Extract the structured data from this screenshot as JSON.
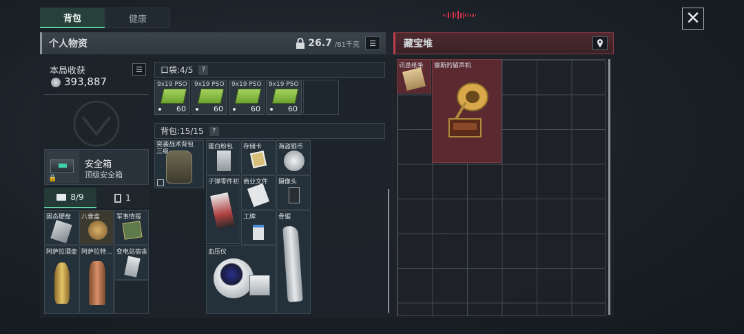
{
  "tabs": {
    "backpack": "背包",
    "health": "健康"
  },
  "left_panel": {
    "title": "个人物资",
    "weight_value": "26.7",
    "weight_capacity": "/81千克"
  },
  "earnings": {
    "label": "本局收获",
    "value": "393,887"
  },
  "safe_box": {
    "name": "安全箱",
    "type": "顶级安全箱"
  },
  "sub_tabs": {
    "count_a": "8/9",
    "count_b": "1"
  },
  "safe_items": [
    "固态硬盘",
    "八音盒",
    "军事情报",
    "阿萨拉酒壶",
    "阿萨拉特...",
    "变电站宿舍"
  ],
  "pocket": {
    "label": "口袋: ",
    "count": "4/5",
    "help": "?"
  },
  "ammo": [
    {
      "name": "9x19 PSO",
      "count": "60"
    },
    {
      "name": "9x19 PSO",
      "count": "60"
    },
    {
      "name": "9x19 PSO",
      "count": "60"
    },
    {
      "name": "9x19 PSO",
      "count": "60"
    }
  ],
  "backpack": {
    "label": "背包: ",
    "count": "15/15",
    "help": "?"
  },
  "backpack_items": {
    "assault_pack": "突袭战术背包 三级",
    "protein": "蛋白粉包",
    "memory_card": "存储卡",
    "pirate_coin": "海盗银币",
    "bullet_parts": "子弹零件初",
    "business_docs": "商业文件",
    "camera": "摄像头",
    "badge": "工牌",
    "bone_saw": "骨锯",
    "blood_pressure": "血压仪"
  },
  "right_panel": {
    "title": "藏宝堆"
  },
  "treasure_items": {
    "intel": "讯息纸条",
    "gramophone": "雷斯的留声机"
  },
  "colors": {
    "accent": "#5fd1a0",
    "treasure": "#c04050",
    "ammo": "#8dc44a"
  }
}
